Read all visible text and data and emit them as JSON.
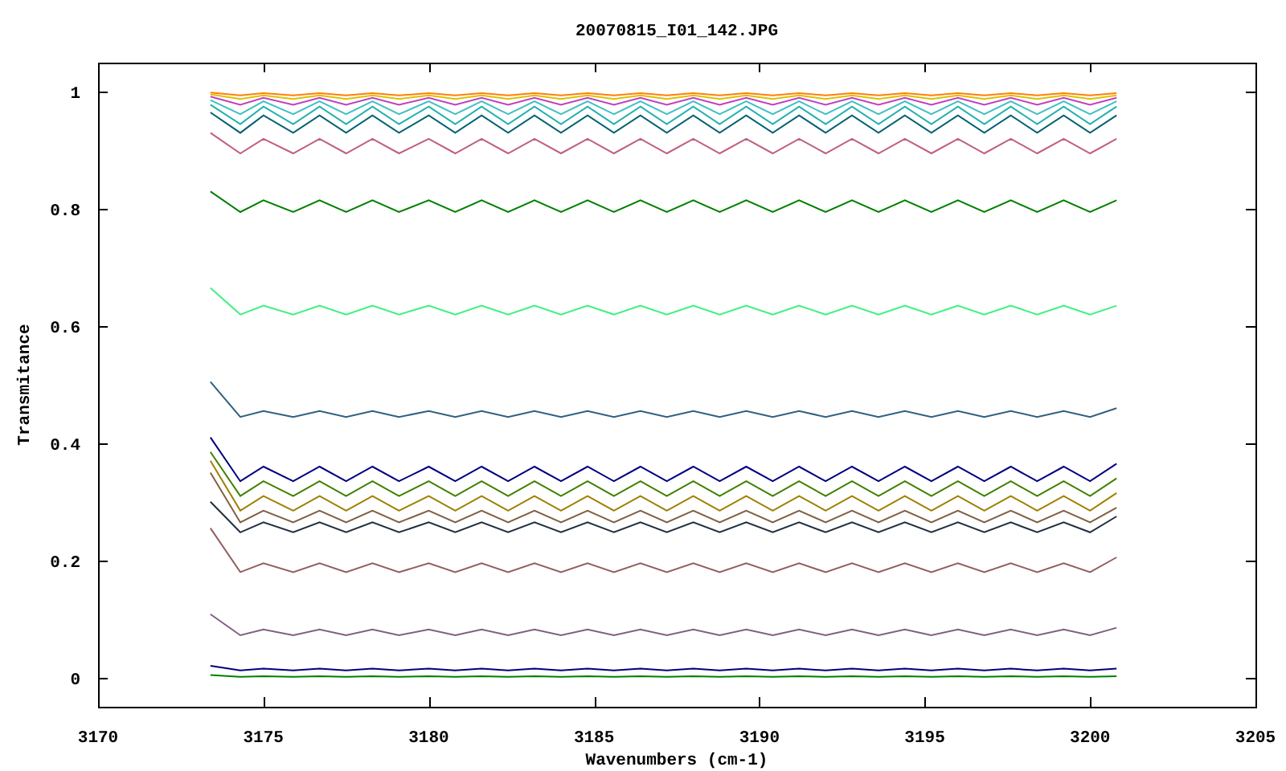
{
  "chart": {
    "chart_data": {
      "type": "line",
      "title": "20070815_I01_142.JPG",
      "xlabel": "Wavenumbers (cm-1)",
      "ylabel": "Transmitance",
      "x": [
        3173.4,
        3174.3,
        3175.0,
        3175.9,
        3176.7,
        3177.5,
        3178.3,
        3179.1,
        3180.0,
        3180.8,
        3181.6,
        3182.4,
        3183.2,
        3184.0,
        3184.8,
        3185.6,
        3186.4,
        3187.2,
        3188.0,
        3188.8,
        3189.6,
        3190.4,
        3191.2,
        3192.0,
        3192.8,
        3193.6,
        3194.4,
        3195.2,
        3196.0,
        3196.8,
        3197.6,
        3198.4,
        3199.2,
        3200.0,
        3200.8
      ],
      "xlim": [
        3170,
        3205
      ],
      "ylim": [
        -0.05,
        1.05
      ],
      "xticks": [
        3170,
        3175,
        3180,
        3185,
        3190,
        3195,
        3200,
        3205
      ],
      "yticks": [
        0,
        0.2,
        0.4,
        0.6,
        0.8,
        1
      ],
      "series": [
        {
          "color": "#ff8000",
          "values": [
            0.999,
            0.994,
            0.998,
            0.994,
            0.998,
            0.994,
            0.998,
            0.994,
            0.998,
            0.994,
            0.998,
            0.994,
            0.998,
            0.994,
            0.998,
            0.994,
            0.998,
            0.994,
            0.998,
            0.994,
            0.998,
            0.994,
            0.998,
            0.994,
            0.998,
            0.994,
            0.998,
            0.994,
            0.998,
            0.994,
            0.998,
            0.994,
            0.998,
            0.994,
            0.998
          ]
        },
        {
          "color": "#e0c000",
          "values": [
            0.996,
            0.988,
            0.994,
            0.988,
            0.994,
            0.988,
            0.994,
            0.988,
            0.994,
            0.988,
            0.994,
            0.988,
            0.994,
            0.988,
            0.994,
            0.988,
            0.994,
            0.988,
            0.994,
            0.988,
            0.994,
            0.988,
            0.994,
            0.988,
            0.994,
            0.988,
            0.994,
            0.988,
            0.994,
            0.988,
            0.994,
            0.988,
            0.994,
            0.988,
            0.994
          ]
        },
        {
          "color": "#c040c0",
          "values": [
            0.992,
            0.978,
            0.99,
            0.978,
            0.99,
            0.978,
            0.99,
            0.978,
            0.99,
            0.978,
            0.99,
            0.978,
            0.99,
            0.978,
            0.99,
            0.978,
            0.99,
            0.978,
            0.99,
            0.978,
            0.99,
            0.978,
            0.99,
            0.978,
            0.99,
            0.978,
            0.99,
            0.978,
            0.99,
            0.978,
            0.99,
            0.978,
            0.99,
            0.978,
            0.99
          ]
        },
        {
          "color": "#40c0c0",
          "values": [
            0.986,
            0.962,
            0.984,
            0.962,
            0.984,
            0.962,
            0.984,
            0.962,
            0.984,
            0.962,
            0.984,
            0.962,
            0.984,
            0.962,
            0.984,
            0.962,
            0.984,
            0.962,
            0.984,
            0.962,
            0.984,
            0.962,
            0.984,
            0.962,
            0.984,
            0.962,
            0.984,
            0.962,
            0.984,
            0.962,
            0.984,
            0.962,
            0.984,
            0.962,
            0.984
          ]
        },
        {
          "color": "#20b0b0",
          "values": [
            0.978,
            0.945,
            0.975,
            0.945,
            0.975,
            0.945,
            0.975,
            0.945,
            0.975,
            0.945,
            0.975,
            0.945,
            0.975,
            0.945,
            0.975,
            0.945,
            0.975,
            0.945,
            0.975,
            0.945,
            0.975,
            0.945,
            0.975,
            0.945,
            0.975,
            0.945,
            0.975,
            0.945,
            0.975,
            0.945,
            0.975,
            0.945,
            0.975,
            0.945,
            0.975
          ]
        },
        {
          "color": "#006070",
          "values": [
            0.965,
            0.93,
            0.96,
            0.93,
            0.96,
            0.93,
            0.96,
            0.93,
            0.96,
            0.93,
            0.96,
            0.93,
            0.96,
            0.93,
            0.96,
            0.93,
            0.96,
            0.93,
            0.96,
            0.93,
            0.96,
            0.93,
            0.96,
            0.93,
            0.96,
            0.93,
            0.96,
            0.93,
            0.96,
            0.93,
            0.96,
            0.93,
            0.96,
            0.93,
            0.96
          ]
        },
        {
          "color": "#c06080",
          "values": [
            0.93,
            0.895,
            0.92,
            0.895,
            0.92,
            0.895,
            0.92,
            0.895,
            0.92,
            0.895,
            0.92,
            0.895,
            0.92,
            0.895,
            0.92,
            0.895,
            0.92,
            0.895,
            0.92,
            0.895,
            0.92,
            0.895,
            0.92,
            0.895,
            0.92,
            0.895,
            0.92,
            0.895,
            0.92,
            0.895,
            0.92,
            0.895,
            0.92,
            0.895,
            0.92
          ]
        },
        {
          "color": "#008000",
          "values": [
            0.83,
            0.795,
            0.815,
            0.795,
            0.815,
            0.795,
            0.815,
            0.795,
            0.815,
            0.795,
            0.815,
            0.795,
            0.815,
            0.795,
            0.815,
            0.795,
            0.815,
            0.795,
            0.815,
            0.795,
            0.815,
            0.795,
            0.815,
            0.795,
            0.815,
            0.795,
            0.815,
            0.795,
            0.815,
            0.795,
            0.815,
            0.795,
            0.815,
            0.795,
            0.815
          ]
        },
        {
          "color": "#40f080",
          "values": [
            0.665,
            0.62,
            0.635,
            0.62,
            0.635,
            0.62,
            0.635,
            0.62,
            0.635,
            0.62,
            0.635,
            0.62,
            0.635,
            0.62,
            0.635,
            0.62,
            0.635,
            0.62,
            0.635,
            0.62,
            0.635,
            0.62,
            0.635,
            0.62,
            0.635,
            0.62,
            0.635,
            0.62,
            0.635,
            0.62,
            0.635,
            0.62,
            0.635,
            0.62,
            0.635
          ]
        },
        {
          "color": "#306080",
          "values": [
            0.505,
            0.445,
            0.455,
            0.445,
            0.455,
            0.445,
            0.455,
            0.445,
            0.455,
            0.445,
            0.455,
            0.445,
            0.455,
            0.445,
            0.455,
            0.445,
            0.455,
            0.445,
            0.455,
            0.445,
            0.455,
            0.445,
            0.455,
            0.445,
            0.455,
            0.445,
            0.455,
            0.445,
            0.455,
            0.445,
            0.455,
            0.445,
            0.455,
            0.445,
            0.46
          ]
        },
        {
          "color": "#000080",
          "values": [
            0.41,
            0.335,
            0.36,
            0.335,
            0.36,
            0.335,
            0.36,
            0.335,
            0.36,
            0.335,
            0.36,
            0.335,
            0.36,
            0.335,
            0.36,
            0.335,
            0.36,
            0.335,
            0.36,
            0.335,
            0.36,
            0.335,
            0.36,
            0.335,
            0.36,
            0.335,
            0.36,
            0.335,
            0.36,
            0.335,
            0.36,
            0.335,
            0.36,
            0.335,
            0.365
          ]
        },
        {
          "color": "#408000",
          "values": [
            0.385,
            0.31,
            0.335,
            0.31,
            0.335,
            0.31,
            0.335,
            0.31,
            0.335,
            0.31,
            0.335,
            0.31,
            0.335,
            0.31,
            0.335,
            0.31,
            0.335,
            0.31,
            0.335,
            0.31,
            0.335,
            0.31,
            0.335,
            0.31,
            0.335,
            0.31,
            0.335,
            0.31,
            0.335,
            0.31,
            0.335,
            0.31,
            0.335,
            0.31,
            0.34
          ]
        },
        {
          "color": "#a08000",
          "values": [
            0.37,
            0.285,
            0.31,
            0.285,
            0.31,
            0.285,
            0.31,
            0.285,
            0.31,
            0.285,
            0.31,
            0.285,
            0.31,
            0.285,
            0.31,
            0.285,
            0.31,
            0.285,
            0.31,
            0.285,
            0.31,
            0.285,
            0.31,
            0.285,
            0.31,
            0.285,
            0.31,
            0.285,
            0.31,
            0.285,
            0.31,
            0.285,
            0.31,
            0.285,
            0.315
          ]
        },
        {
          "color": "#806040",
          "values": [
            0.35,
            0.265,
            0.285,
            0.265,
            0.285,
            0.265,
            0.285,
            0.265,
            0.285,
            0.265,
            0.285,
            0.265,
            0.285,
            0.265,
            0.285,
            0.265,
            0.285,
            0.265,
            0.285,
            0.265,
            0.285,
            0.265,
            0.285,
            0.265,
            0.285,
            0.265,
            0.285,
            0.265,
            0.285,
            0.265,
            0.285,
            0.265,
            0.285,
            0.265,
            0.29
          ]
        },
        {
          "color": "#203040",
          "values": [
            0.3,
            0.248,
            0.265,
            0.248,
            0.265,
            0.248,
            0.265,
            0.248,
            0.265,
            0.248,
            0.265,
            0.248,
            0.265,
            0.248,
            0.265,
            0.248,
            0.265,
            0.248,
            0.265,
            0.248,
            0.265,
            0.248,
            0.265,
            0.248,
            0.265,
            0.248,
            0.265,
            0.248,
            0.265,
            0.248,
            0.265,
            0.248,
            0.265,
            0.248,
            0.275
          ]
        },
        {
          "color": "#906060",
          "values": [
            0.255,
            0.18,
            0.195,
            0.18,
            0.195,
            0.18,
            0.195,
            0.18,
            0.195,
            0.18,
            0.195,
            0.18,
            0.195,
            0.18,
            0.195,
            0.18,
            0.195,
            0.18,
            0.195,
            0.18,
            0.195,
            0.18,
            0.195,
            0.18,
            0.195,
            0.18,
            0.195,
            0.18,
            0.195,
            0.18,
            0.195,
            0.18,
            0.195,
            0.18,
            0.205
          ]
        },
        {
          "color": "#806080",
          "values": [
            0.108,
            0.072,
            0.082,
            0.072,
            0.082,
            0.072,
            0.082,
            0.072,
            0.082,
            0.072,
            0.082,
            0.072,
            0.082,
            0.072,
            0.082,
            0.072,
            0.082,
            0.072,
            0.082,
            0.072,
            0.082,
            0.072,
            0.082,
            0.072,
            0.082,
            0.072,
            0.082,
            0.072,
            0.082,
            0.072,
            0.082,
            0.072,
            0.082,
            0.072,
            0.085
          ]
        },
        {
          "color": "#000080",
          "values": [
            0.02,
            0.012,
            0.015,
            0.012,
            0.015,
            0.012,
            0.015,
            0.012,
            0.015,
            0.012,
            0.015,
            0.012,
            0.015,
            0.012,
            0.015,
            0.012,
            0.015,
            0.012,
            0.015,
            0.012,
            0.015,
            0.012,
            0.015,
            0.012,
            0.015,
            0.012,
            0.015,
            0.012,
            0.015,
            0.012,
            0.015,
            0.012,
            0.015,
            0.012,
            0.015
          ]
        },
        {
          "color": "#008000",
          "values": [
            0.004,
            0.001,
            0.002,
            0.001,
            0.002,
            0.001,
            0.002,
            0.001,
            0.002,
            0.001,
            0.002,
            0.001,
            0.002,
            0.001,
            0.002,
            0.001,
            0.002,
            0.001,
            0.002,
            0.001,
            0.002,
            0.001,
            0.002,
            0.001,
            0.002,
            0.001,
            0.002,
            0.001,
            0.002,
            0.001,
            0.002,
            0.001,
            0.002,
            0.001,
            0.002
          ]
        }
      ]
    }
  }
}
